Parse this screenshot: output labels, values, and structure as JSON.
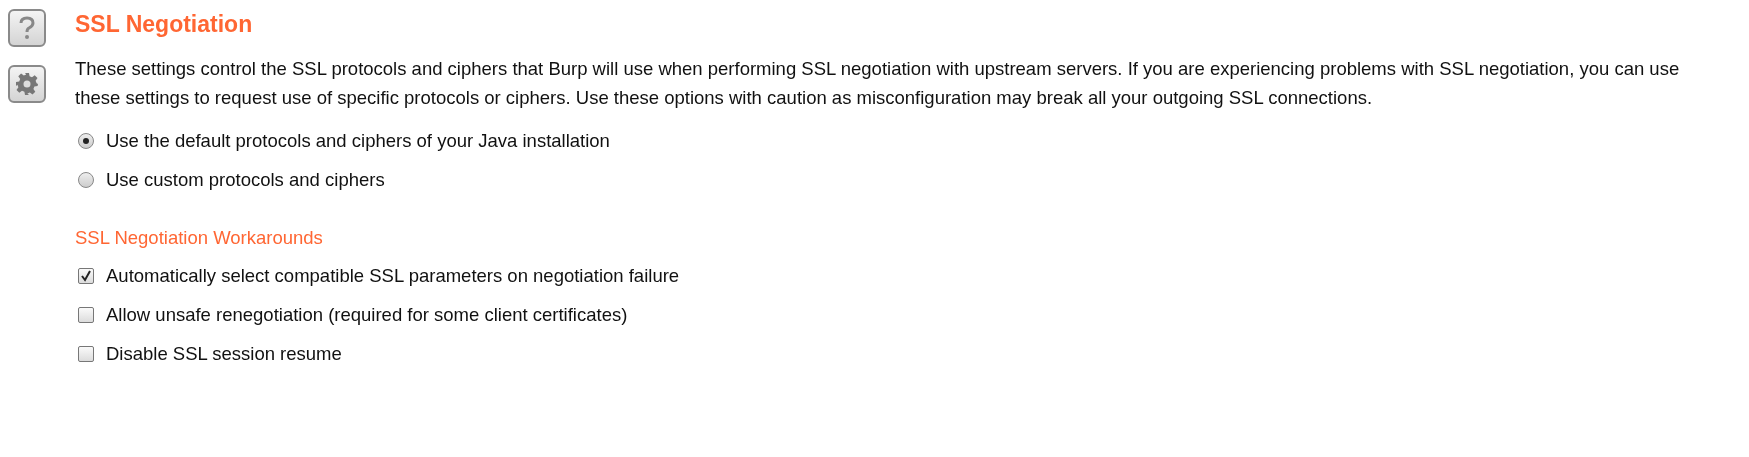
{
  "title": "SSL Negotiation",
  "description": "These settings control the SSL protocols and ciphers that Burp will use when performing SSL negotiation with upstream servers. If you are experiencing problems with SSL negotiation, you can use these settings to request use of specific protocols or ciphers. Use these options with caution as misconfiguration may break all your outgoing SSL connections.",
  "radios": [
    {
      "label": "Use the default protocols and ciphers of your Java installation",
      "selected": true
    },
    {
      "label": "Use custom protocols and ciphers",
      "selected": false
    }
  ],
  "workarounds": {
    "heading": "SSL Negotiation Workarounds",
    "options": [
      {
        "label": "Automatically select compatible SSL parameters on negotiation failure",
        "checked": true
      },
      {
        "label": "Allow unsafe renegotiation (required for some client certificates)",
        "checked": false
      },
      {
        "label": "Disable SSL session resume",
        "checked": false
      }
    ]
  }
}
